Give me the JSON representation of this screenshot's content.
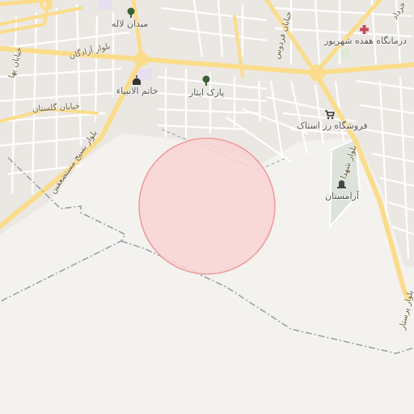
{
  "map": {
    "colors": {
      "land": "#f4f2ef",
      "urban": "#e9e6e2",
      "major_road": "#fbdc8a",
      "minor_road": "#ffffff",
      "park": "#dfe8d6",
      "cemetery": "#dde3da",
      "circle_fill": "#f8d3d3",
      "circle_stroke": "#ef9a9a",
      "boundary": "#9a9aa6"
    },
    "places": [
      {
        "name": "میدان لاله",
        "icon": "tree-icon"
      },
      {
        "name": "پارک ایثار",
        "icon": "tree-icon"
      },
      {
        "name": "خاتم الانبیاء",
        "icon": "mosque-icon"
      },
      {
        "name": "درمانگاه هفده شهریور",
        "icon": "medical-cross-icon"
      },
      {
        "name": "فروشگاه رز استاک",
        "icon": "shopping-cart-icon"
      },
      {
        "name": "آرامستان",
        "icon": "cemetery-icon"
      }
    ],
    "roads": {
      "azadegan": "بلوار آزادگان",
      "golestan": "خیابان گلستان",
      "basij": "بلوار بسیج مستضعفین",
      "shohada": "بلوار شهدا",
      "ferdows": "خیابان فردوس",
      "bahar": "خیابان بها",
      "khordad": "خرداد",
      "parastar": "بلوار پرستار"
    }
  }
}
